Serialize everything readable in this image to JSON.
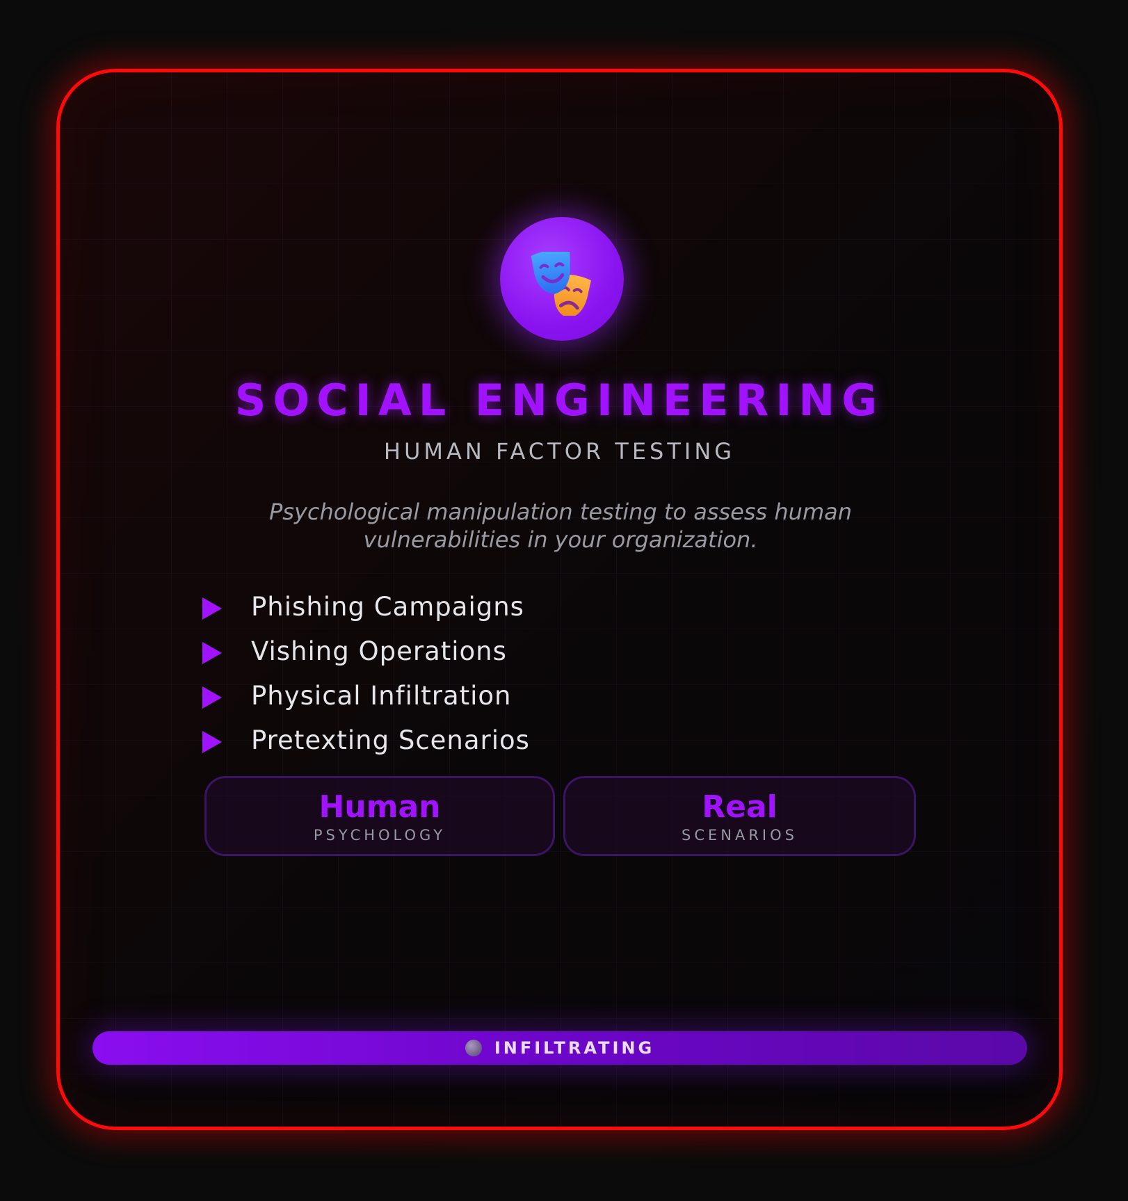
{
  "card": {
    "title": "SOCIAL ENGINEERING",
    "subtitle": "HUMAN FACTOR TESTING",
    "description": "Psychological manipulation testing to assess human vulnerabilities in your organization.",
    "icon": "theater-masks-icon",
    "features": [
      {
        "label": "Phishing Campaigns"
      },
      {
        "label": "Vishing Operations"
      },
      {
        "label": "Physical Infiltration"
      },
      {
        "label": "Pretexting Scenarios"
      }
    ],
    "stats": [
      {
        "value": "Human",
        "label": "PSYCHOLOGY"
      },
      {
        "value": "Real",
        "label": "SCENARIOS"
      }
    ],
    "status": {
      "label": "INFILTRATING"
    }
  },
  "colors": {
    "border": "#ff0a0a",
    "accent": "#a112ff",
    "background": "#0b0b0b"
  }
}
